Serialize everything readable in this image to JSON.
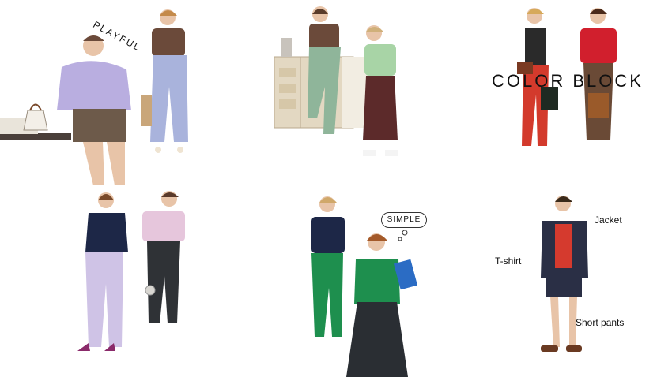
{
  "panels": [
    {
      "name": "playful",
      "label": "PLAYFUL"
    },
    {
      "name": "kitchen",
      "label": ""
    },
    {
      "name": "color-block",
      "label": "COLOR BLOCK"
    },
    {
      "name": "lavender",
      "label": ""
    },
    {
      "name": "simple",
      "label": "SIMPLE"
    },
    {
      "name": "parts",
      "labels": {
        "tshirt": "T-shirt",
        "jacket": "Jacket",
        "short_pants": "Short pants"
      }
    }
  ],
  "colors": {
    "lavender": "#b9aee0",
    "periwinkle": "#a9b3dc",
    "brown_top": "#6b4a3a",
    "sage": "#8fb59a",
    "mint": "#a8d4a6",
    "maroon": "#5c2a2a",
    "red": "#d33a2c",
    "navy": "#1d2747",
    "green": "#1e8f4e",
    "charcoal": "#2f3236",
    "pink_tee": "#e6c6dc",
    "lilac_pant": "#cfc3e6"
  }
}
